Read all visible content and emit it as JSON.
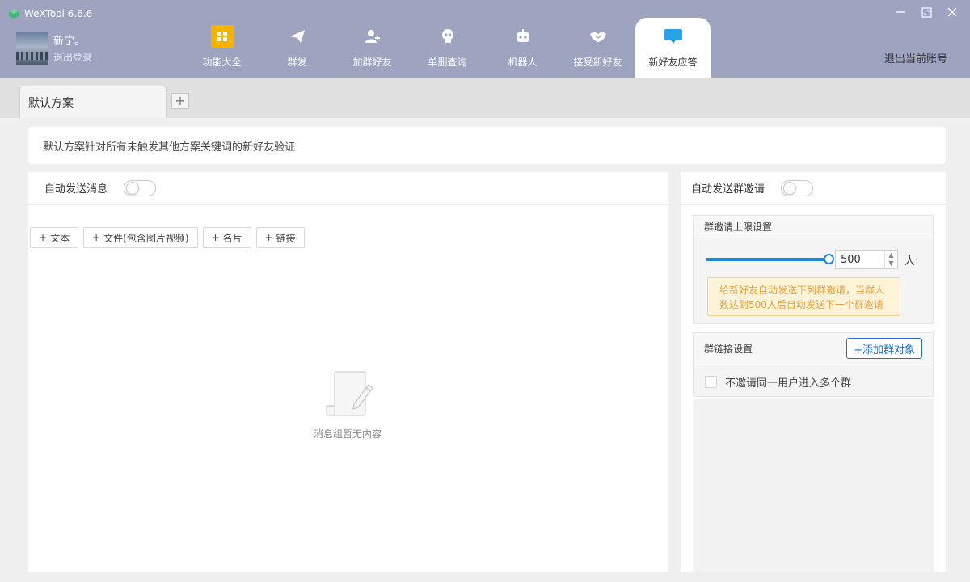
{
  "app": {
    "title": "WeXTool 6.6.6"
  },
  "profile": {
    "name": "新宁。",
    "logout_label": "退出登录"
  },
  "nav": {
    "items": [
      {
        "label": "功能大全",
        "icon": "grid-icon"
      },
      {
        "label": "群发",
        "icon": "paper-plane-icon"
      },
      {
        "label": "加群好友",
        "icon": "add-user-icon"
      },
      {
        "label": "单删查询",
        "icon": "skull-icon"
      },
      {
        "label": "机器人",
        "icon": "robot-icon"
      },
      {
        "label": "接受新好友",
        "icon": "handshake-icon"
      },
      {
        "label": "新好友应答",
        "icon": "chat-icon"
      }
    ],
    "active": "新好友应答",
    "account_exit_label": "退出当前账号"
  },
  "tabs": {
    "default_label": "默认方案",
    "add_label": "+"
  },
  "description": "默认方案针对所有未触发其他方案关键词的新好友验证",
  "auto_message": {
    "title": "自动发送消息",
    "enabled": false,
    "buttons": [
      {
        "prefix": "+",
        "label": "文本"
      },
      {
        "prefix": "+",
        "label": "文件(包含图片视频)"
      },
      {
        "prefix": "+",
        "label": "名片"
      },
      {
        "prefix": "+",
        "label": "链接"
      }
    ],
    "empty_text": "消息组暂无内容"
  },
  "group_invite": {
    "title": "自动发送群邀请",
    "enabled": false,
    "limit": {
      "title": "群邀请上限设置",
      "value": "500",
      "slider_fraction": 1.0,
      "unit": "人",
      "notice_line1": "给新好友自动发送下列群邀请，当群人",
      "notice_line2": "数达到500人后自动发送下一个群邀请"
    },
    "link": {
      "title": "群链接设置",
      "add_button": "+添加群对象",
      "checkbox_label": "不邀请同一用户进入多个群",
      "checked": false
    }
  },
  "colors": {
    "topbar": "#9ea3c0",
    "accent_blue": "#1e88d6",
    "notice_text": "#e6a23c",
    "grid_icon_bg": "#f5b400",
    "chat_icon": "#2aa0e6"
  }
}
